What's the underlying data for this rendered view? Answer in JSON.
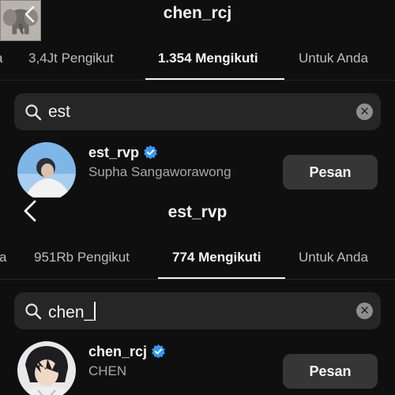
{
  "screen1": {
    "title": "chen_rcj",
    "tabs": [
      "3,4Jt Pengikut",
      "1.354 Mengikuti",
      "Untuk Anda"
    ],
    "active_tab": 1,
    "search": {
      "query": "est",
      "clear_icon": "clear-icon"
    },
    "result": {
      "username": "est_rvp",
      "full_name": "Supha Sangaworawong",
      "verified": true,
      "button_label": "Pesan"
    }
  },
  "screen2": {
    "title": "est_rvp",
    "tabs": [
      "a",
      "951Rb Pengikut",
      "774 Mengikuti",
      "Untuk Anda"
    ],
    "active_tab": 2,
    "search": {
      "query": "chen_",
      "clear_icon": "clear-icon"
    },
    "result": {
      "username": "chen_rcj",
      "full_name": "CHEN",
      "verified": true,
      "button_label": "Pesan"
    }
  },
  "colors": {
    "background": "#0f0f0f",
    "search_bg": "#262626",
    "button_bg": "#363636",
    "verified_blue": "#3897f0",
    "muted_text": "#a8a8a8"
  },
  "icons": [
    "back-icon",
    "elephant-logo-icon",
    "search-icon",
    "clear-icon",
    "verified-badge-icon"
  ]
}
